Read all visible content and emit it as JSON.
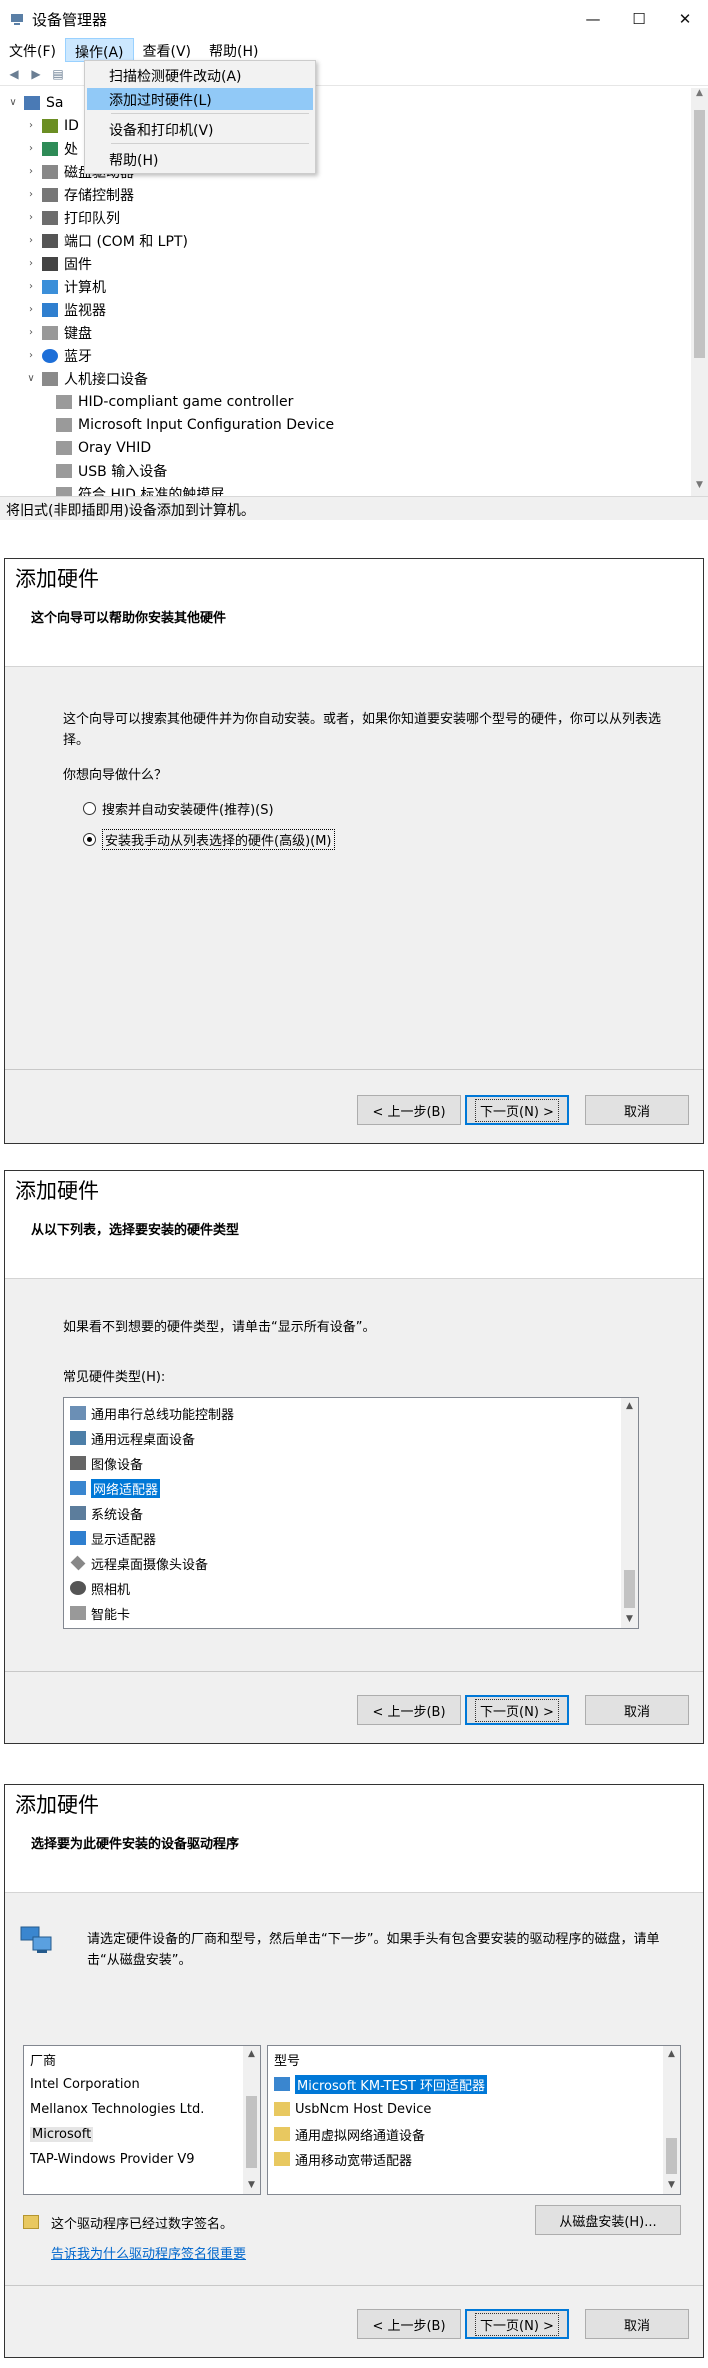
{
  "device_manager": {
    "title": "设备管理器",
    "menu": [
      "文件(F)",
      "操作(A)",
      "查看(V)",
      "帮助(H)"
    ],
    "root_node": "Sa",
    "tree": [
      {
        "label": "ID",
        "icon": "ide-icon"
      },
      {
        "label": "处",
        "icon": "processor-icon"
      },
      {
        "label": "磁盘驱动器",
        "icon": "disk-icon"
      },
      {
        "label": "存储控制器",
        "icon": "storage-icon"
      },
      {
        "label": "打印队列",
        "icon": "printer-icon"
      },
      {
        "label": "端口 (COM 和 LPT)",
        "icon": "port-icon"
      },
      {
        "label": "固件",
        "icon": "firmware-icon"
      },
      {
        "label": "计算机",
        "icon": "computer-icon"
      },
      {
        "label": "监视器",
        "icon": "monitor-icon"
      },
      {
        "label": "键盘",
        "icon": "keyboard-icon"
      },
      {
        "label": "蓝牙",
        "icon": "bluetooth-icon"
      },
      {
        "label": "人机接口设备",
        "icon": "hid-icon"
      }
    ],
    "hid_children": [
      "HID-compliant game controller",
      "Microsoft Input Configuration Device",
      "Oray VHID",
      "USB 输入设备",
      "符合 HID 标准的触摸屏"
    ],
    "status": "将旧式(非即插即用)设备添加到计算机。",
    "action_menu": {
      "items": [
        "扫描检测硬件改动(A)",
        "添加过时硬件(L)",
        "设备和打印机(V)",
        "帮助(H)"
      ]
    }
  },
  "wizard1": {
    "title": "添加硬件",
    "subtitle": "这个向导可以帮助你安装其他硬件",
    "desc": "这个向导可以搜索其他硬件并为你自动安装。或者，如果你知道要安装哪个型号的硬件，你可以从列表选择。",
    "question": "你想向导做什么？",
    "option1": "搜索并自动安装硬件(推荐)(S)",
    "option2": "安装我手动从列表选择的硬件(高级)(M)"
  },
  "wizard2": {
    "title": "添加硬件",
    "subtitle": "从以下列表，选择要安装的硬件类型",
    "desc": "如果看不到想要的硬件类型，请单击“显示所有设备”。",
    "list_label": "常见硬件类型(H):",
    "items": [
      "通用串行总线功能控制器",
      "通用远程桌面设备",
      "图像设备",
      "网络适配器",
      "系统设备",
      "显示适配器",
      "远程桌面摄像头设备",
      "照相机",
      "智能卡"
    ],
    "selected_index": 3
  },
  "wizard3": {
    "title": "添加硬件",
    "subtitle": "选择要为此硬件安装的设备驱动程序",
    "desc": "请选定硬件设备的厂商和型号，然后单击“下一步”。如果手头有包含要安装的驱动程序的磁盘，请单击“从磁盘安装”。",
    "manufacturer_label": "厂商",
    "manufacturers": [
      "Intel Corporation",
      "Mellanox Technologies Ltd.",
      "Microsoft",
      "TAP-Windows Provider V9"
    ],
    "model_label": "型号",
    "models": [
      "Microsoft KM-TEST 环回适配器",
      "UsbNcm Host Device",
      "通用虚拟网络通道设备",
      "通用移动宽带适配器"
    ],
    "signed_text": "这个驱动程序已经过数字签名。",
    "signing_link": "告诉我为什么驱动程序签名很重要",
    "have_disk": "从磁盘安装(H)..."
  },
  "buttons": {
    "back": "< 上一步(B)",
    "next": "下一页(N) >",
    "cancel": "取消"
  }
}
